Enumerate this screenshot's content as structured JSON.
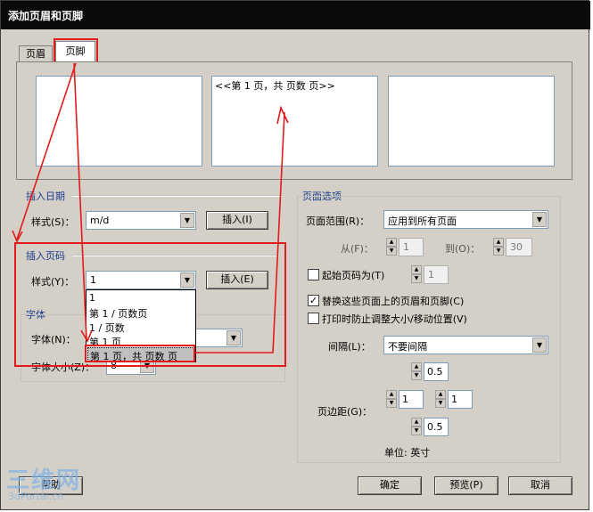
{
  "dialog": {
    "title": "添加页眉和页脚"
  },
  "tabs": [
    {
      "label": "页眉"
    },
    {
      "label": "页脚"
    }
  ],
  "footer_boxes": {
    "left": "",
    "center": "<<第 1 页，共 页数 页>>",
    "right": ""
  },
  "insert_date": {
    "group_label": "插入日期",
    "style_label": "样式(S)：",
    "style_value": "m/d",
    "insert_button": "插入(I)"
  },
  "insert_page_number": {
    "group_label": "插入页码",
    "style_label": "样式(Y)：",
    "style_value": "1",
    "insert_button": "插入(E)",
    "dropdown_options": [
      "1",
      "第 1 / 页数页",
      "1 / 页数",
      "第 1 页",
      "第 1 页，共 页数 页"
    ],
    "selected_option": "第 1 页，共 页数 页"
  },
  "font": {
    "group_label": "字体",
    "font_label": "字体(N)：",
    "size_label": "字体大小(Z)：",
    "size_value": "8"
  },
  "page_options": {
    "group_label": "页面选项",
    "range_label": "页面范围(R)：",
    "range_value": "应用到所有页面",
    "from_label": "从(F)：",
    "from_value": "1",
    "to_label": "到(O)：",
    "to_value": "30",
    "start_checkbox_label": "起始页码为(T)",
    "start_checked": false,
    "start_value": "1",
    "replace_checkbox_label": "替换这些页面上的页眉和页脚(C)",
    "replace_checked": true,
    "prevent_checkbox_label": "打印时防止调整大小/移动位置(V)",
    "prevent_checked": false,
    "spacing_label": "间隔(L)：",
    "spacing_value": "不要间隔",
    "spacing_number": "0.5",
    "margin_label": "页边距(G)：",
    "margin_left": "1",
    "margin_right": "1",
    "margin_bottom": "0.5",
    "unit_text": "单位: 英寸"
  },
  "buttons": {
    "help": "帮助",
    "ok": "确定",
    "preview": "预览(P)",
    "cancel": "取消"
  },
  "watermark": {
    "text_large": "三维网",
    "text_small": "3dPortal.cn"
  },
  "annotation": {
    "color": "#e21a1a"
  }
}
